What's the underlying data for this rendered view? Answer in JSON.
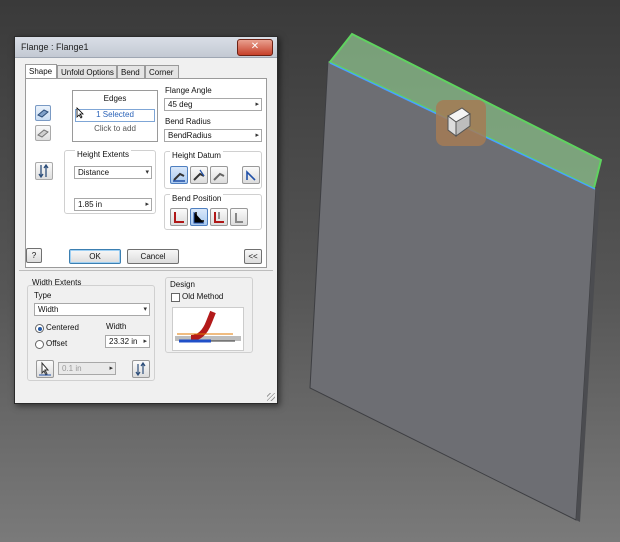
{
  "dialog": {
    "title": "Flange : Flange1",
    "close_glyph": "✕",
    "tabs": [
      {
        "label": "Shape"
      },
      {
        "label": "Unfold Options"
      },
      {
        "label": "Bend"
      },
      {
        "label": "Corner"
      }
    ],
    "edges": {
      "header": "Edges",
      "selected": "1 Selected",
      "add": "Click to add"
    },
    "flange_angle": {
      "label": "Flange Angle",
      "value": "45 deg"
    },
    "bend_radius": {
      "label": "Bend Radius",
      "value": "BendRadius"
    },
    "height_extents": {
      "label": "Height Extents",
      "type": "Distance",
      "distance": "1.85 in"
    },
    "height_datum": {
      "label": "Height Datum"
    },
    "bend_position": {
      "label": "Bend Position"
    },
    "buttons": {
      "help": "?",
      "ok": "OK",
      "cancel": "Cancel",
      "collapse": "<<"
    },
    "width_extents": {
      "label": "Width Extents",
      "type_label": "Type",
      "type_value": "Width",
      "centered": "Centered",
      "offset": "Offset",
      "width_label": "Width",
      "width_value": "23.32 in",
      "offset_value": "0.1 in"
    },
    "design": {
      "label": "Design",
      "old_method": "Old Method"
    }
  },
  "colors": {
    "flange_highlight": "#5fd35f",
    "part_face": "#6a6b70",
    "glyph_badge": "#a57b55"
  }
}
